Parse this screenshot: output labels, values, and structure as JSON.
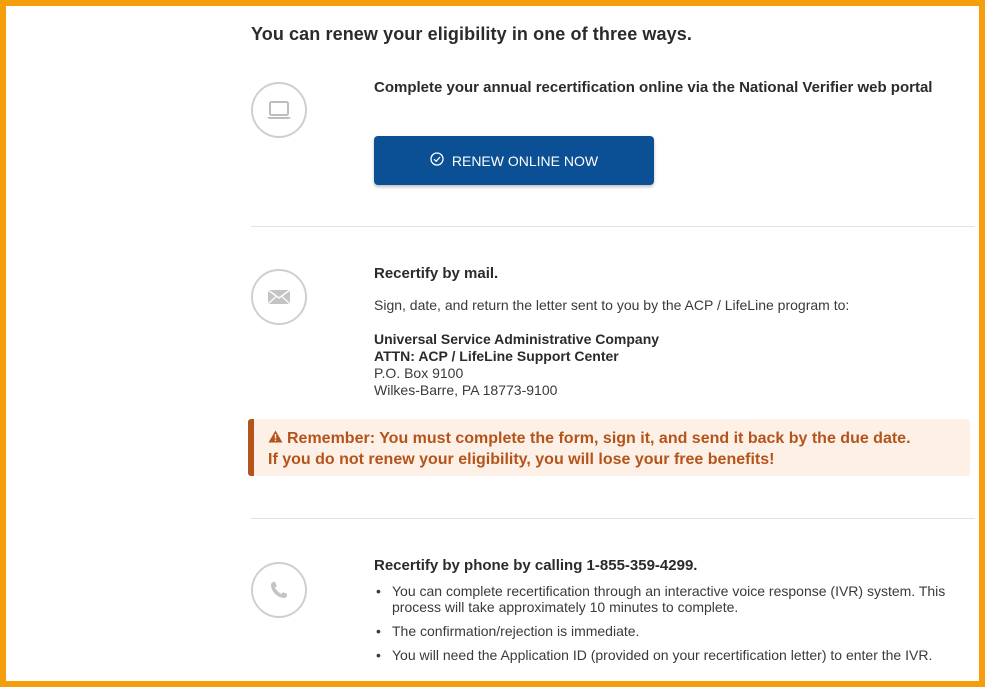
{
  "heading": "You can renew your eligibility in one of three ways.",
  "online": {
    "icon": "laptop-icon",
    "title": "Complete your annual recertification online via the National Verifier web portal",
    "button_label": "RENEW ONLINE NOW",
    "button_icon": "check-circle-icon"
  },
  "mail": {
    "icon": "envelope-icon",
    "title": "Recertify by mail.",
    "instruction": "Sign, date, and return the letter sent to you by the ACP / LifeLine program to:",
    "address": {
      "line1": "Universal Service Administrative Company",
      "line2": "ATTN: ACP / LifeLine Support Center",
      "line3": "P.O. Box 9100",
      "line4": "Wilkes-Barre, PA 18773-9100"
    }
  },
  "alert": {
    "icon": "warning-icon",
    "line1": "Remember: You must complete the form, sign it, and send it back by the due date.",
    "line2": "If you do not renew your eligibility, you will lose your free benefits!"
  },
  "phone": {
    "icon": "phone-icon",
    "title": "Recertify by phone by calling 1-855-359-4299.",
    "bullets": [
      "You can complete recertification through an interactive voice response (IVR) system. This process will take approximately 10 minutes to complete.",
      "The confirmation/rejection is immediate.",
      "You will need the Application ID (provided on your recertification letter) to enter the IVR."
    ]
  },
  "colors": {
    "frame": "#f59e0b",
    "button": "#0b4f94",
    "alert_text": "#b5541a",
    "alert_bg": "#fdf1e7"
  }
}
